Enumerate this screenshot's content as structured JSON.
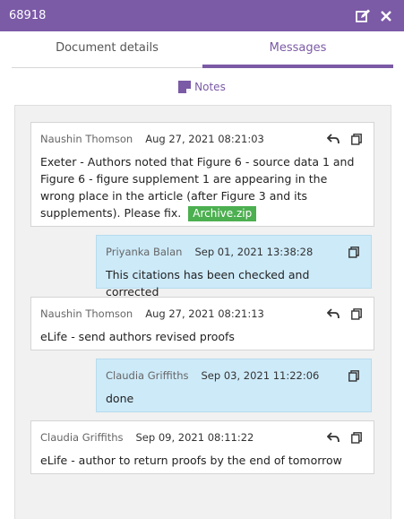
{
  "window": {
    "title": "68918"
  },
  "tabs": [
    {
      "label": "Document details"
    },
    {
      "label": "Messages"
    }
  ],
  "notes": {
    "label": "Notes"
  },
  "messages": [
    {
      "author": "Naushin Thomson",
      "date": "Aug 27, 2021 08:21:03",
      "text": "Exeter - Authors noted that Figure 6 - source data 1 and Figure 6 - figure supplement 1 are appearing in the wrong place in the article (after Figure 3 and its supplements). Please fix.",
      "attachment": "Archive.zip"
    },
    {
      "author": "Priyanka Balan",
      "date": "Sep 01, 2021 13:38:28",
      "text": "This citations has been checked and corrected"
    },
    {
      "author": "Naushin Thomson",
      "date": "Aug 27, 2021 08:21:13",
      "text": "eLife - send authors revised proofs"
    },
    {
      "author": "Claudia Griffiths",
      "date": "Sep 03, 2021 11:22:06",
      "text": "done"
    },
    {
      "author": "Claudia Griffiths",
      "date": "Sep 09, 2021 08:11:22",
      "text": "eLife - author to return proofs by the end of tomorrow"
    }
  ],
  "colors": {
    "accent": "#7b5aa6",
    "reply_bg": "#cdeaf9",
    "attachment": "#4caf50"
  }
}
